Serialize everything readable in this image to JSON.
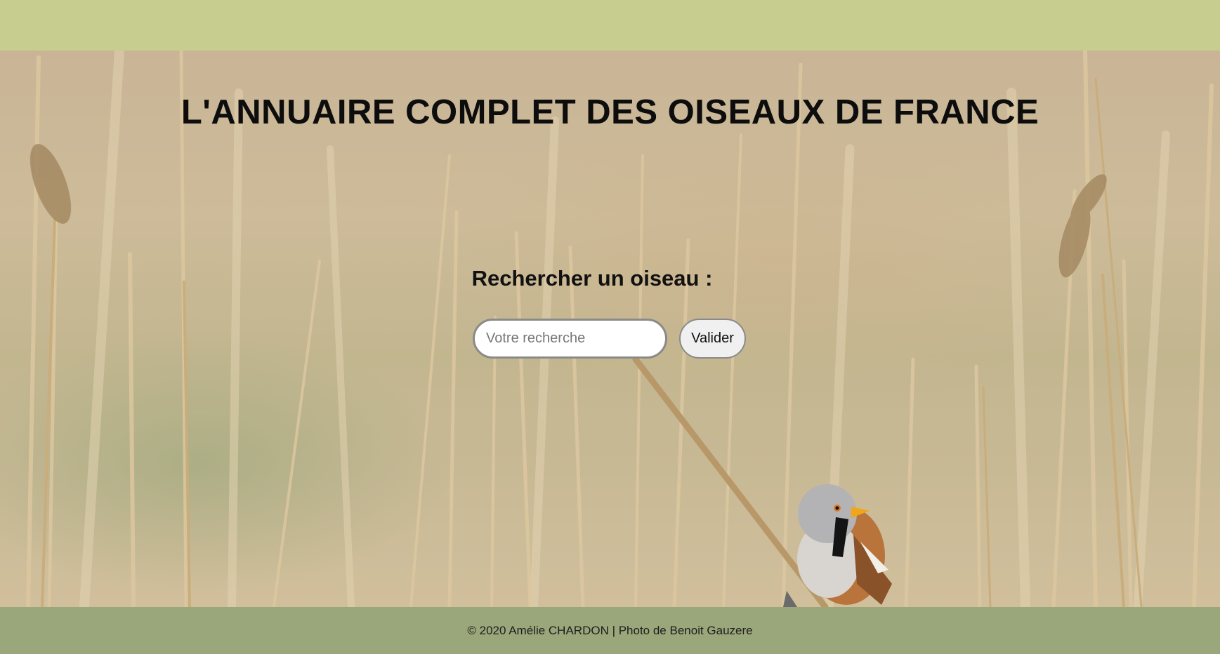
{
  "header": {
    "title": "L'ANNUAIRE COMPLET DES OISEAUX DE FRANCE"
  },
  "search": {
    "heading": "Rechercher un oiseau :",
    "placeholder": "Votre recherche",
    "value": "",
    "button_label": "Valider"
  },
  "footer": {
    "credit": "© 2020 Amélie CHARDON | Photo de Benoit Gauzere"
  },
  "colors": {
    "top_bar": "#c6cd8e",
    "footer": "#9aa77b",
    "title_text": "#0d0d0d"
  },
  "hero_image": {
    "subject": "bearded-reedling-bird-on-reed"
  }
}
